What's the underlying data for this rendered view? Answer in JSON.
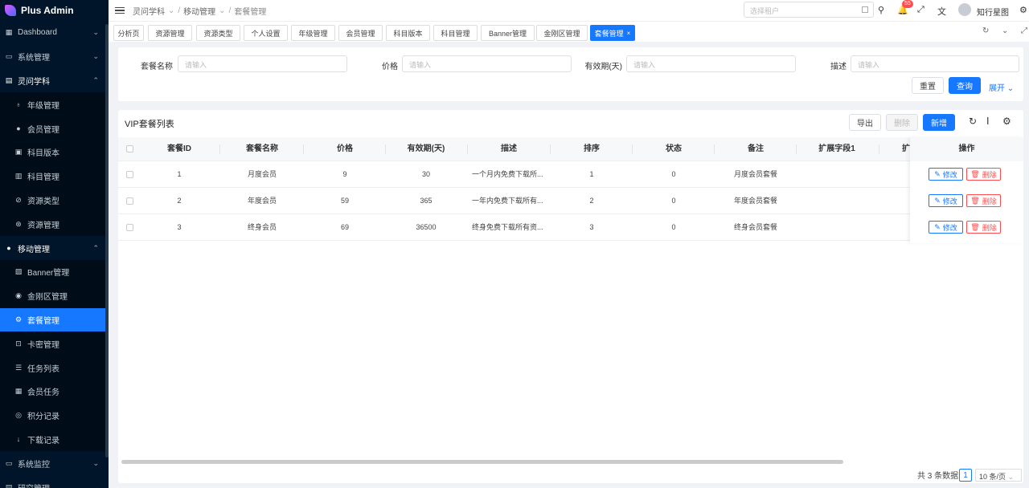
{
  "app": {
    "title": "Plus Admin"
  },
  "sidebar": {
    "items": [
      {
        "label": "Dashboard",
        "icon": "grid-icon",
        "chev": "⌄"
      },
      {
        "label": "系统管理",
        "icon": "monitor-icon",
        "chev": "⌄"
      },
      {
        "label": "灵问学科",
        "icon": "doc-icon",
        "chev": "⌃"
      },
      {
        "label": "年级管理",
        "icon": "mic-icon",
        "sub": true
      },
      {
        "label": "会员管理",
        "icon": "chat-icon",
        "sub": true
      },
      {
        "label": "科目版本",
        "icon": "calendar-icon",
        "sub": true
      },
      {
        "label": "科目管理",
        "icon": "book-icon",
        "sub": true
      },
      {
        "label": "资源类型",
        "icon": "link-icon",
        "sub": true
      },
      {
        "label": "资源管理",
        "icon": "circle-icon",
        "sub": true
      },
      {
        "label": "移动管理",
        "icon": "wechat-icon",
        "chev": "⌃"
      },
      {
        "label": "Banner管理",
        "icon": "image-icon",
        "sub": true
      },
      {
        "label": "金刚区管理",
        "icon": "eye-icon",
        "sub": true
      },
      {
        "label": "套餐管理",
        "icon": "gear-icon",
        "sub": true,
        "active": true
      },
      {
        "label": "卡密管理",
        "icon": "lock-icon",
        "sub": true
      },
      {
        "label": "任务列表",
        "icon": "list-icon",
        "sub": true
      },
      {
        "label": "会员任务",
        "icon": "table-icon",
        "sub": true
      },
      {
        "label": "积分记录",
        "icon": "coin-icon",
        "sub": true
      },
      {
        "label": "下载记录",
        "icon": "download-icon",
        "sub": true
      },
      {
        "label": "系统监控",
        "icon": "monitor-icon",
        "chev": "⌄"
      },
      {
        "label": "研究管理",
        "icon": "doc-icon",
        "chev": "⌄"
      }
    ]
  },
  "header": {
    "breadcrumb": [
      "灵问学科",
      "移动管理",
      "套餐管理"
    ],
    "tenant_placeholder": "选择租户",
    "notification_count": "55",
    "user_name": "知行星图"
  },
  "tabs": [
    {
      "label": "分析页"
    },
    {
      "label": "资源管理"
    },
    {
      "label": "资源类型"
    },
    {
      "label": "个人设置"
    },
    {
      "label": "年级管理"
    },
    {
      "label": "会员管理"
    },
    {
      "label": "科目版本"
    },
    {
      "label": "科目管理"
    },
    {
      "label": "Banner管理"
    },
    {
      "label": "金刚区管理"
    },
    {
      "label": "套餐管理",
      "active": true
    }
  ],
  "search": {
    "fields": [
      {
        "label": "套餐名称",
        "placeholder": "请输入"
      },
      {
        "label": "价格",
        "placeholder": "请输入"
      },
      {
        "label": "有效期(天)",
        "placeholder": "请输入"
      },
      {
        "label": "描述",
        "placeholder": "请输入"
      }
    ],
    "reset_label": "重置",
    "query_label": "查询",
    "expand_label": "展开"
  },
  "table": {
    "title": "VIP套餐列表",
    "export_label": "导出",
    "delete_label": "删除",
    "add_label": "新增",
    "columns": [
      "套餐ID",
      "套餐名称",
      "价格",
      "有效期(天)",
      "描述",
      "排序",
      "状态",
      "备注",
      "扩展字段1",
      "扩",
      "操作"
    ],
    "rows": [
      {
        "id": "1",
        "name": "月度会员",
        "price": "9",
        "days": "30",
        "desc": "一个月内免费下载所...",
        "sort": "1",
        "status": "0",
        "remark": "月度会员套餐"
      },
      {
        "id": "2",
        "name": "年度会员",
        "price": "59",
        "days": "365",
        "desc": "一年内免费下载所有...",
        "sort": "2",
        "status": "0",
        "remark": "年度会员套餐"
      },
      {
        "id": "3",
        "name": "终身会员",
        "price": "69",
        "days": "36500",
        "desc": "终身免费下载所有资...",
        "sort": "3",
        "status": "0",
        "remark": "终身会员套餐"
      }
    ],
    "edit_label": "修改",
    "row_delete_label": "删除"
  },
  "pagination": {
    "total_text": "共 3 条数据",
    "current_page": "1",
    "page_size": "10 条/页"
  },
  "colors": {
    "primary": "#1677ff",
    "danger": "#ff4d4f",
    "sidebar_bg": "#001529"
  }
}
